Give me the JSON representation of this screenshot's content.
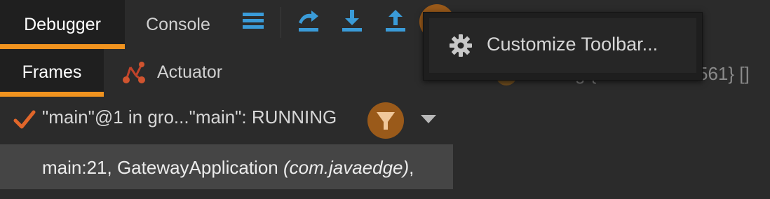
{
  "toolbar": {
    "tabs": [
      {
        "label": "Debugger"
      },
      {
        "label": "Console"
      }
    ]
  },
  "subtabs": {
    "frames_label": "Frames",
    "actuator_label": "Actuator"
  },
  "thread": {
    "label": "\"main\"@1 in gro...\"main\": RUNNING"
  },
  "frame": {
    "location": "main:21, GatewayApplication ",
    "package": "(com.javaedge)",
    "suffix": ","
  },
  "popup": {
    "item_label": "Customize Toolbar..."
  },
  "background_peek": {
    "text1": "g  {",
    "text2": "561} []"
  },
  "colors": {
    "accent": "#f0931f",
    "icon_blue": "#3a9bd8",
    "check_orange": "#e0662a"
  }
}
